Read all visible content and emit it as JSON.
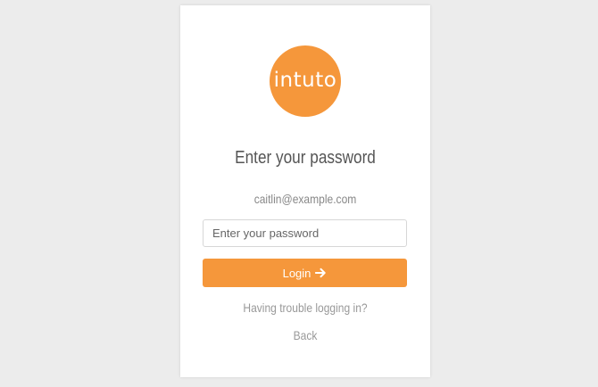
{
  "brand": {
    "logo_text": "intuto",
    "color": "#f5973b"
  },
  "login": {
    "heading": "Enter your password",
    "email": "caitlin@example.com",
    "password_placeholder": "Enter your password",
    "password_value": "",
    "login_label": "Login",
    "login_icon": "arrow-right-icon",
    "trouble_link": "Having trouble logging in?",
    "back_link": "Back"
  }
}
